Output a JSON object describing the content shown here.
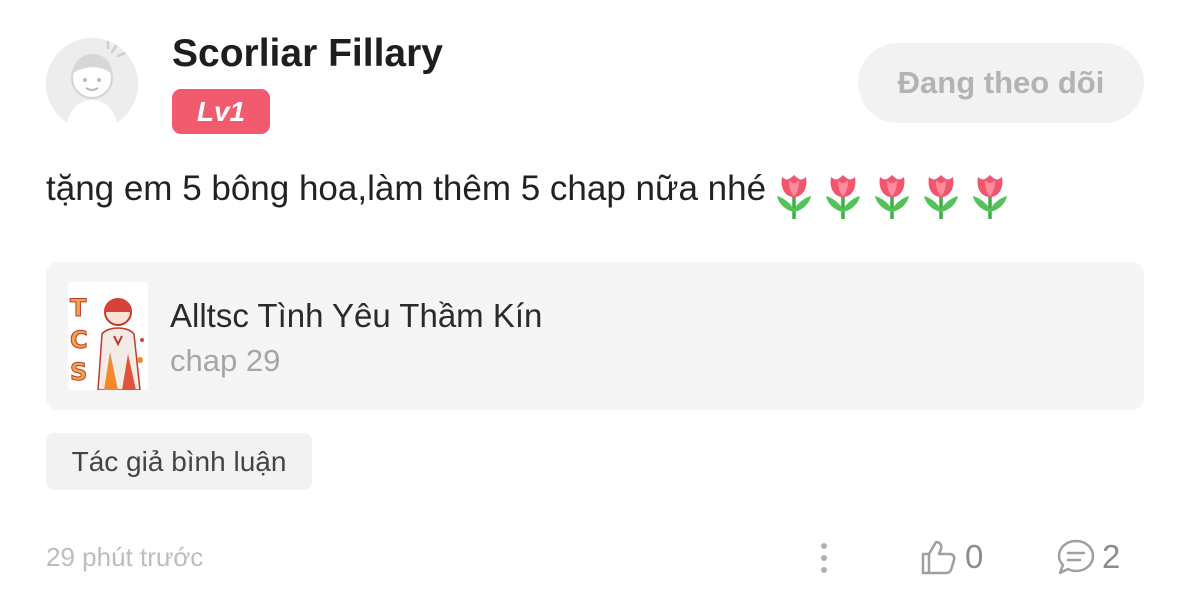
{
  "user": {
    "name": "Scorliar Fillary",
    "level": "Lv1",
    "avatar_icon": "default-avatar-icon"
  },
  "follow_button": {
    "label": "Đang theo dõi"
  },
  "comment": {
    "text": "tặng em 5 bông hoa,làm thêm 5 chap nữa nhé",
    "emoji": [
      "tulip-icon",
      "tulip-icon",
      "tulip-icon",
      "tulip-icon",
      "tulip-icon"
    ]
  },
  "story": {
    "title": "Alltsc Tình Yêu Thầm Kín",
    "chapter": "chap 29",
    "cover_text": "TCS"
  },
  "author_tag": {
    "label": "Tác giả bình luận"
  },
  "footer": {
    "timestamp": "29 phút trước",
    "more_icon": "more-vertical-icon",
    "like_icon": "thumbs-up-icon",
    "like_count": "0",
    "reply_icon": "comment-bubble-icon",
    "reply_count": "2"
  },
  "colors": {
    "level_badge": "#f25a6e",
    "follow_bg": "#f2f2f2",
    "muted_text": "#bdbdbd",
    "card_bg": "#f5f5f5"
  }
}
